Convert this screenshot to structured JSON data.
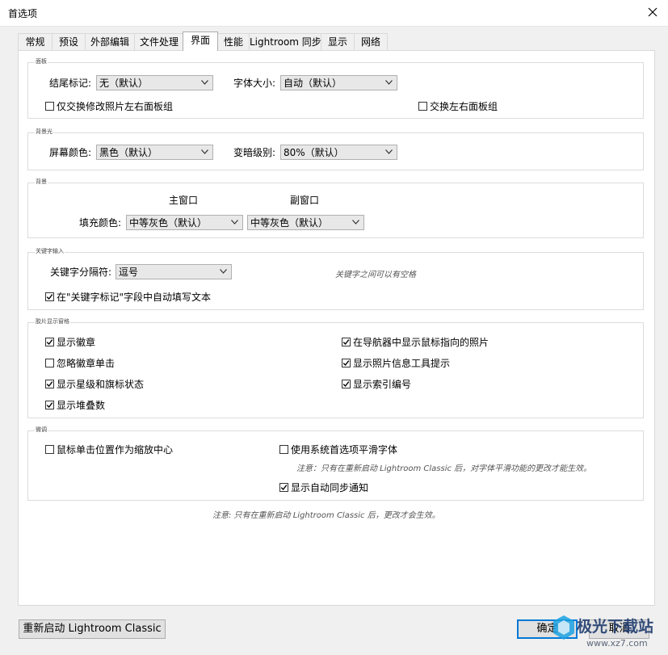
{
  "window": {
    "title": "首选项"
  },
  "tabs": [
    {
      "label": "常规"
    },
    {
      "label": "预设"
    },
    {
      "label": "外部编辑"
    },
    {
      "label": "文件处理"
    },
    {
      "label": "界面"
    },
    {
      "label": "性能"
    },
    {
      "label": "Lightroom 同步"
    },
    {
      "label": "显示"
    },
    {
      "label": "网络"
    }
  ],
  "active_tab": "界面",
  "panels": {
    "title": "面板",
    "end_marks_label": "结尾标记:",
    "end_marks_value": "无（默认）",
    "font_size_label": "字体大小:",
    "font_size_value": "自动（默认）",
    "swap_modify_left_right": "仅交换修改照片左右面板组",
    "swap_left_right": "交换左右面板组"
  },
  "lights_out": {
    "title": "背景光",
    "screen_color_label": "屏幕颜色:",
    "screen_color_value": "黑色（默认）",
    "dim_level_label": "变暗级别:",
    "dim_level_value": "80%（默认）"
  },
  "background": {
    "title": "背景",
    "main_window_label": "主窗口",
    "secondary_window_label": "副窗口",
    "fill_color_label": "填充颜色:",
    "main_fill_value": "中等灰色（默认）",
    "secondary_fill_value": "中等灰色（默认）"
  },
  "keyword_entry": {
    "title": "关键字输入",
    "separator_label": "关键字分隔符:",
    "separator_value": "逗号",
    "spaces_note": "关键字之间可以有空格",
    "autofill": "在\"关键字标记\"字段中自动填写文本"
  },
  "filmstrip": {
    "title": "胶片显示窗格",
    "show_badges": "显示徽章",
    "ignore_badge_clicks": "忽略徽章单击",
    "show_ratings_picks": "显示星级和旗标状态",
    "show_stack_counts": "显示堆叠数",
    "show_photos_in_navigator": "在导航器中显示鼠标指向的照片",
    "show_info_tooltips": "显示照片信息工具提示",
    "show_index_number": "显示索引编号"
  },
  "tweaks": {
    "title": "微调",
    "zoom_clicked_point": "鼠标单击位置作为缩放中心",
    "use_system_smoothing": "使用系统首选项平滑字体",
    "smoothing_note": "注意：只有在重新启动 Lightroom Classic 后，对字体平滑功能的更改才能生效。",
    "show_sync_notifications": "显示自动同步通知"
  },
  "footer_note": "注意: 只有在重新启动 Lightroom Classic 后，更改才会生效。",
  "buttons": {
    "restart": "重新启动 Lightroom Classic",
    "ok": "确定",
    "cancel": "取消"
  },
  "checkbox_states": {
    "swap_modify_left_right": false,
    "swap_left_right": false,
    "autofill": true,
    "show_badges": true,
    "ignore_badge_clicks": false,
    "show_ratings_picks": true,
    "show_stack_counts": true,
    "show_photos_in_navigator": true,
    "show_info_tooltips": true,
    "show_index_number": true,
    "zoom_clicked_point": false,
    "use_system_smoothing": false,
    "show_sync_notifications": true
  },
  "watermark": {
    "text": "极光下载站",
    "url": "www.xz7.com"
  },
  "colors": {
    "accent": "#0078d7",
    "window_bg": "#f0f0f0",
    "panel_bg": "#ffffff"
  }
}
